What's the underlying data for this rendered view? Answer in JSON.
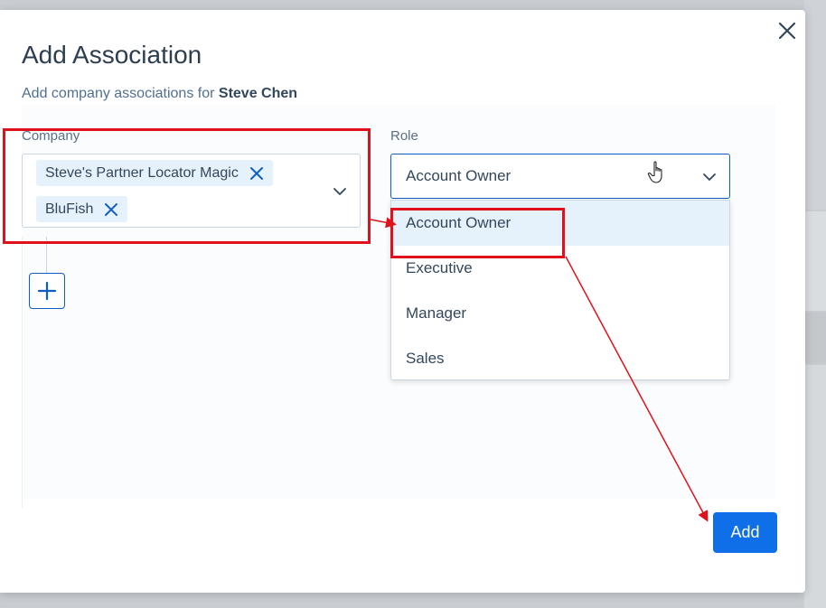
{
  "modal": {
    "title": "Add Association",
    "subtitle_prefix": "Add company associations for",
    "subtitle_name": "Steve Chen"
  },
  "company": {
    "label": "Company",
    "selected": [
      {
        "label": "Steve's Partner Locator Magic"
      },
      {
        "label": "BluFish"
      }
    ]
  },
  "role": {
    "label": "Role",
    "value": "Account Owner",
    "options": [
      {
        "label": "Account Owner",
        "active": true
      },
      {
        "label": "Executive",
        "active": false
      },
      {
        "label": "Manager",
        "active": false
      },
      {
        "label": "Sales",
        "active": false
      }
    ]
  },
  "actions": {
    "add_label": "Add"
  },
  "colors": {
    "primary": "#0f6fe8",
    "annotation": "#e0111d",
    "chip_bg": "#e5f1fb"
  },
  "icons": [
    "close-icon",
    "chip-remove-icon",
    "chevron-down-icon",
    "plus-icon",
    "hand-pointer-icon"
  ]
}
